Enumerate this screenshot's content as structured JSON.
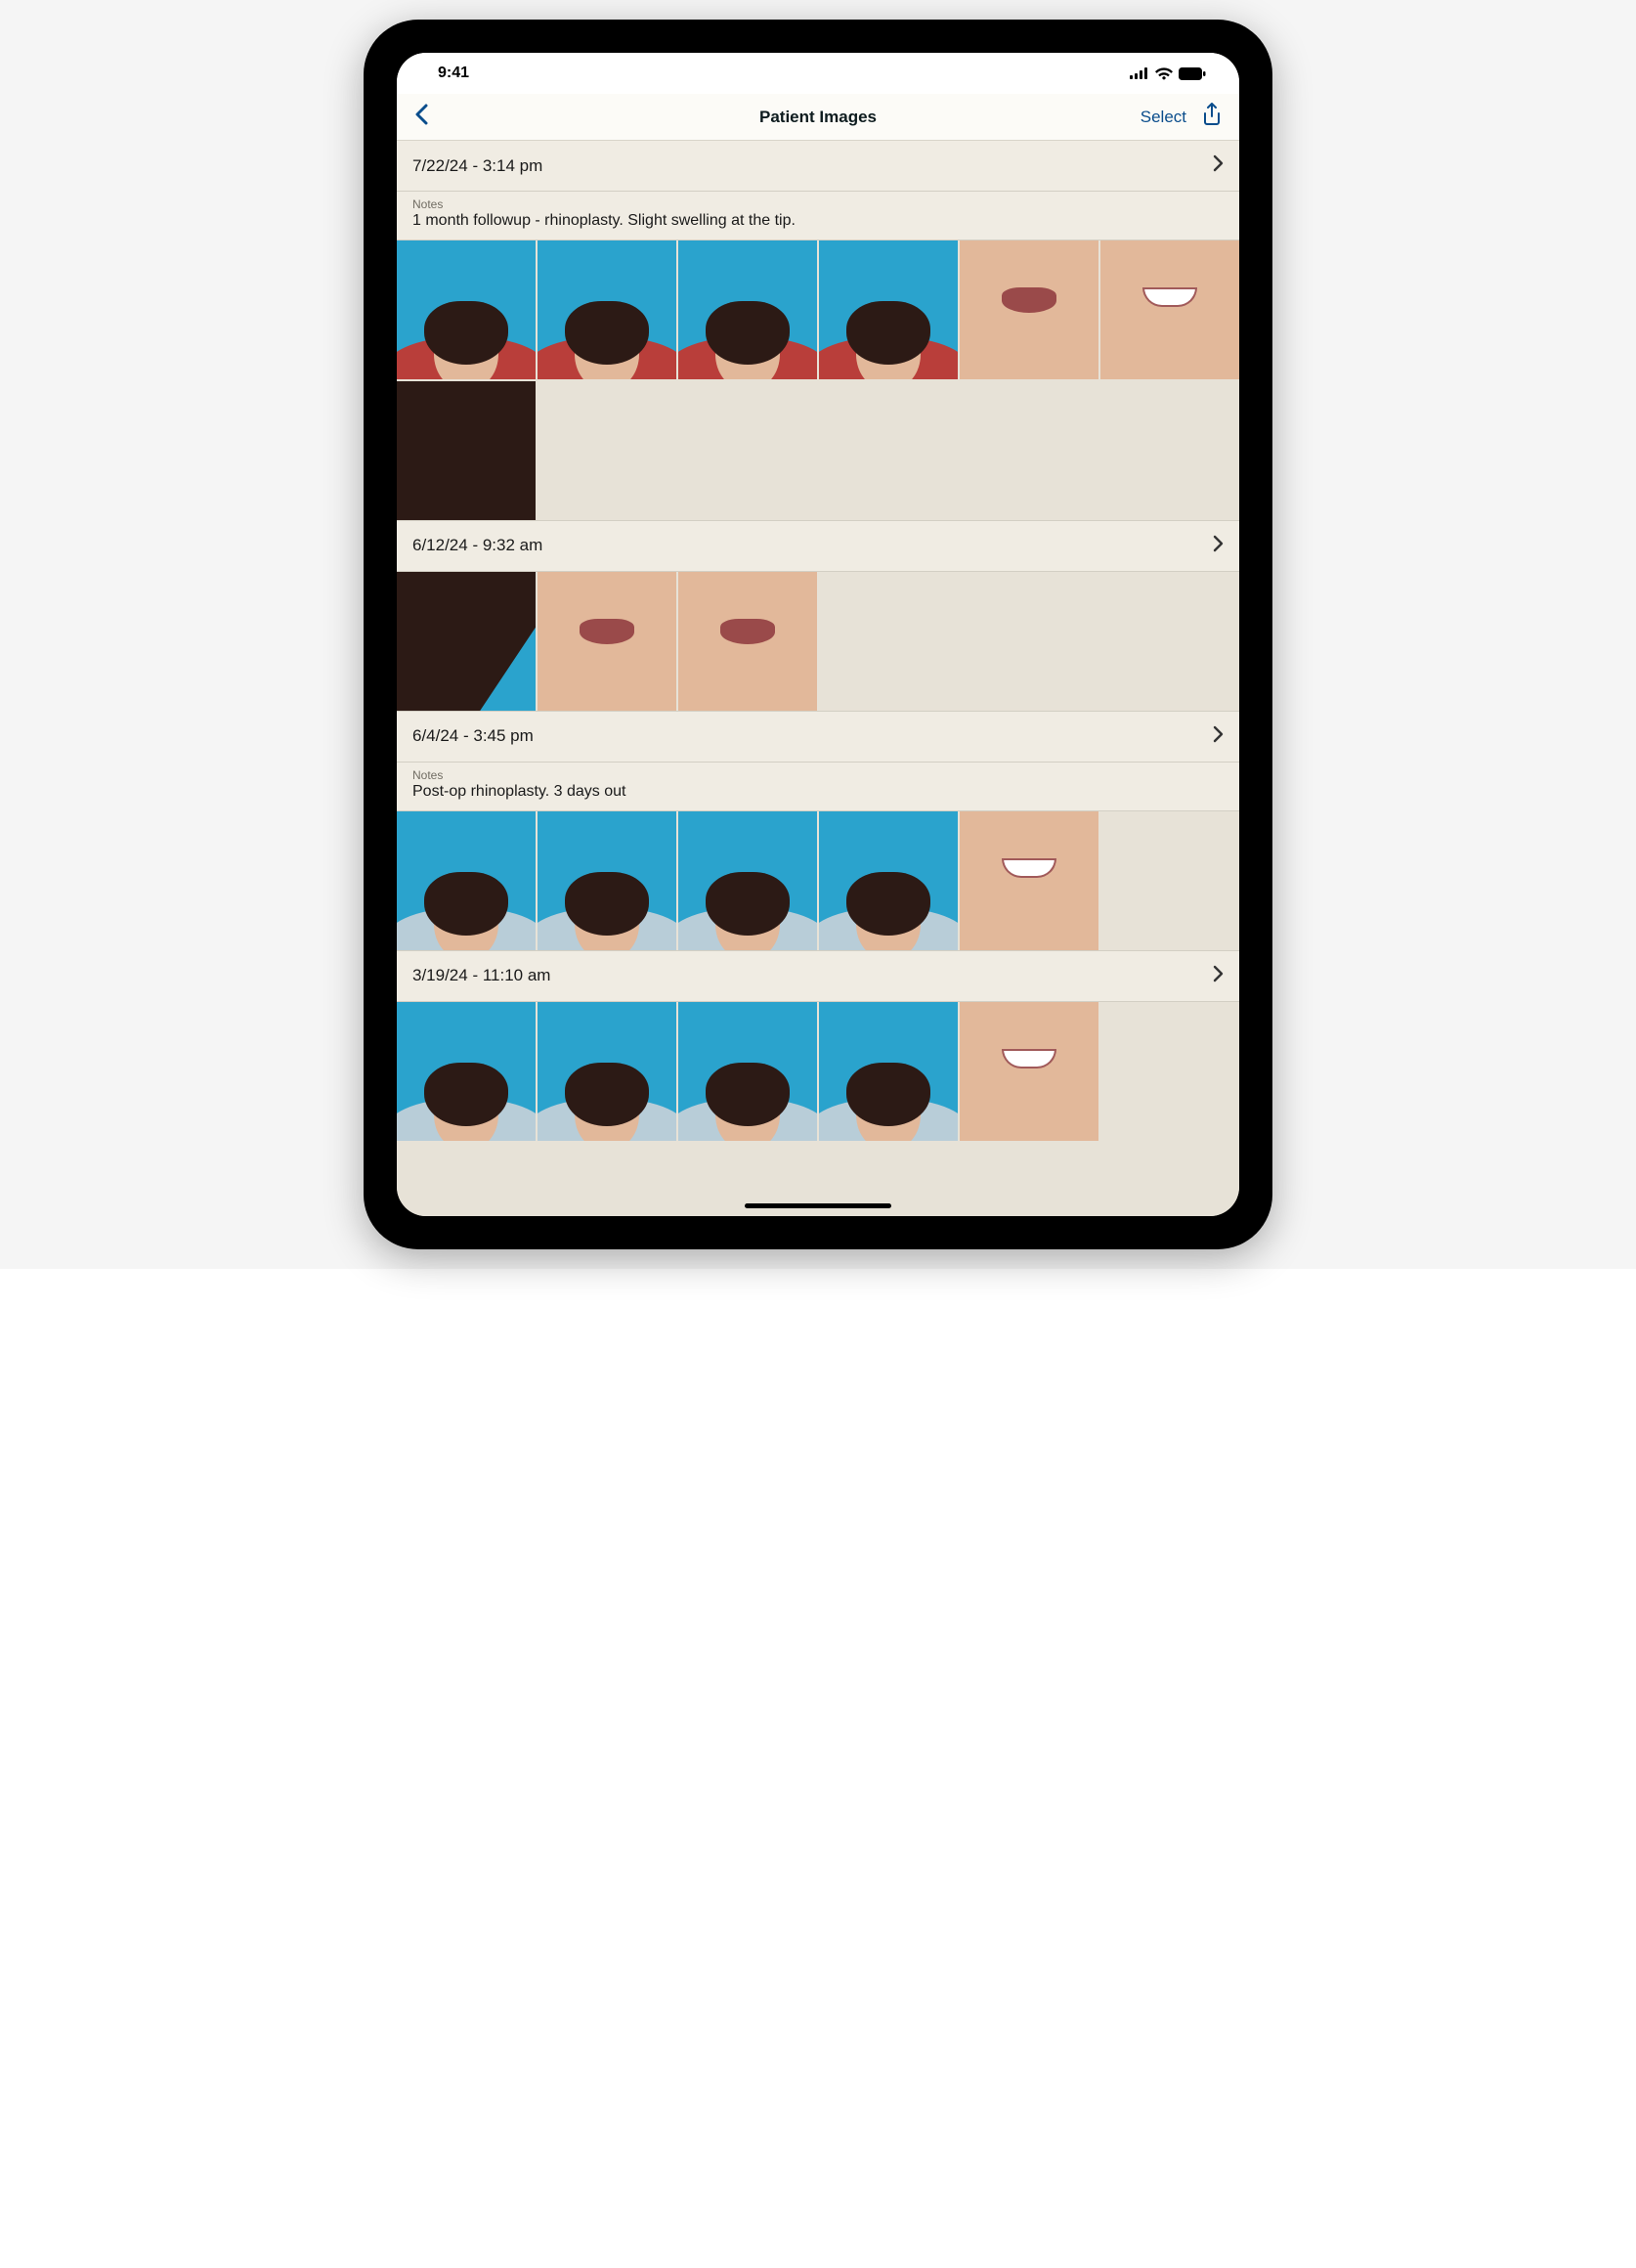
{
  "status": {
    "time": "9:41"
  },
  "nav": {
    "title": "Patient Images",
    "select_label": "Select"
  },
  "notes_label": "Notes",
  "sessions": [
    {
      "timestamp": "7/22/24 - 3:14 pm",
      "notes": "1 month followup - rhinoplasty. Slight swelling at the tip.",
      "thumb_count": 7,
      "thumb_style": "red"
    },
    {
      "timestamp": "6/12/24 - 9:32 am",
      "notes": "",
      "thumb_count": 3,
      "thumb_style": "closeup"
    },
    {
      "timestamp": "6/4/24 - 3:45 pm",
      "notes": "Post-op rhinoplasty. 3 days out",
      "thumb_count": 5,
      "thumb_style": "blue"
    },
    {
      "timestamp": "3/19/24 - 11:10 am",
      "notes": "",
      "thumb_count": 5,
      "thumb_style": "blue"
    }
  ]
}
